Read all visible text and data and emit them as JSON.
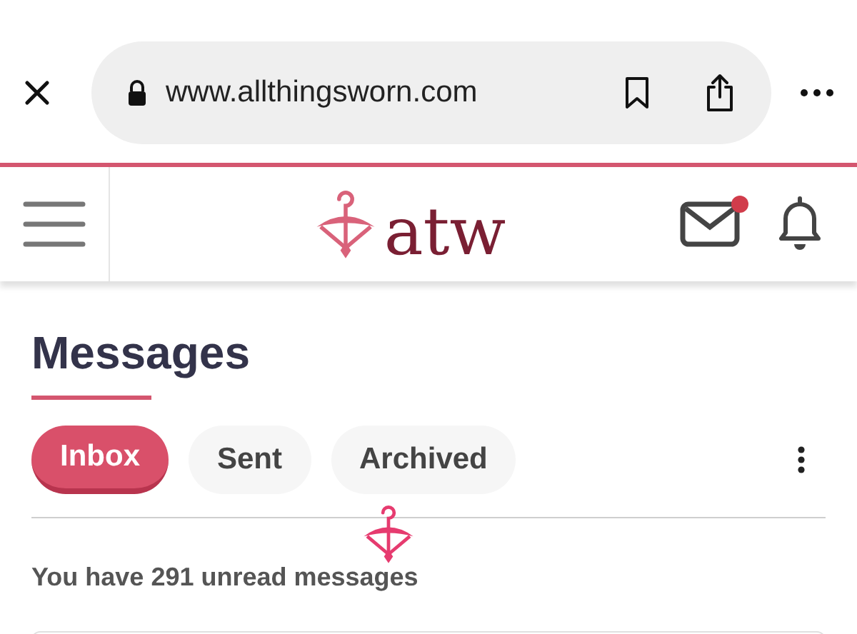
{
  "browser": {
    "url": "www.allthingsworn.com"
  },
  "header": {
    "logo": "atw",
    "mail_unread": true
  },
  "page": {
    "title": "Messages"
  },
  "tabs": [
    {
      "label": "Inbox",
      "selected": true
    },
    {
      "label": "Sent",
      "selected": false
    },
    {
      "label": "Archived",
      "selected": false
    }
  ],
  "summary": "You have 291 unread messages"
}
